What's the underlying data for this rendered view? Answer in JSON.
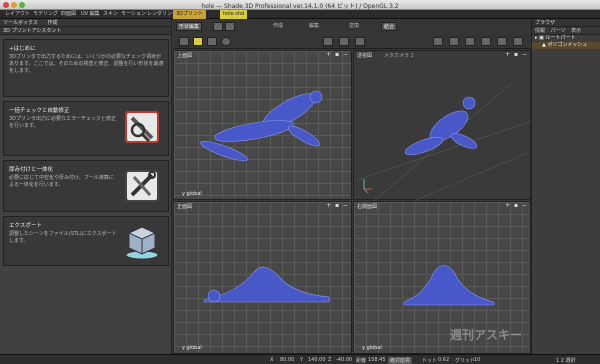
{
  "window": {
    "title": "hole — Shade 3D Professional ver.14.1.0 (64 ビット) / OpenGL 3.2"
  },
  "tabs": [
    {
      "label": "レイアウト"
    },
    {
      "label": "モデリング"
    },
    {
      "label": "四面図"
    },
    {
      "label": "UV 編集"
    },
    {
      "label": "スキン"
    },
    {
      "label": "モーション"
    },
    {
      "label": "レンダリング"
    },
    {
      "label": "3Dプリント"
    },
    {
      "label": "hole.shd"
    }
  ],
  "left_panel": {
    "toolbox_label": "ツールボックス",
    "create_label": "作成",
    "assistant_label": "3D プリントアシスタント",
    "cards": [
      {
        "title": "+はじめに",
        "desc": "3Dプリンタで出力するためには、いくつかの必要なチェック項目があります。ここでは、そのための検査と修正、調整を行い形状を最適化します。",
        "icon": "info-icon"
      },
      {
        "title": "一括チェックと自動修正",
        "desc": "3Dプリンタ出力に必要なエラーチェックと修正を行います。",
        "icon": "wrench-magnifier-icon"
      },
      {
        "title": "厚み付けと一体化",
        "desc": "必要に応じて中空化や厚み付け、ブール演算による一体化を行います。",
        "icon": "tools-icon"
      },
      {
        "title": "エクスポート",
        "desc": "調整したシーンをファイル(STL)にエクスポートします。",
        "icon": "cube-export-icon"
      }
    ]
  },
  "toolbar": {
    "shape_edit_label": "形状編集",
    "create_label": "作成",
    "edit_label": "編集",
    "transform_label": "変換",
    "join_label": "結合",
    "items": [
      "camera-icon",
      "cursor-icon",
      "grid-icon",
      "render-icon"
    ]
  },
  "viewports": [
    {
      "label": "上面図",
      "sub": "",
      "axis": "y global"
    },
    {
      "label": "透視図",
      "sub": "メタカメラ 1",
      "axis": ""
    },
    {
      "label": "正面図",
      "sub": "",
      "axis": "y global"
    },
    {
      "label": "右側面図",
      "sub": "",
      "axis": "y global"
    }
  ],
  "right_panel": {
    "header": "ブラウザ",
    "tabs": [
      "情報",
      "パーツ",
      "表示"
    ],
    "tree": [
      {
        "label": "ルートパート"
      },
      {
        "label": "ポリゴンメッシュ"
      }
    ]
  },
  "status": {
    "x_label": "X",
    "x": "80.00",
    "y_label": "Y",
    "y": "140.00",
    "z_label": "Z",
    "z": "-40.00",
    "dist_label": "距離",
    "dist": "158.45",
    "mode": "絶対座標",
    "dot_label": "ドット",
    "dot": "0.62",
    "grid_label": "グリッド",
    "grid": "10",
    "right": "1 2 選択"
  },
  "watermark": "週刊アスキー",
  "colors": {
    "accent_yellow": "#d8cc40",
    "print_tab": "#c8a23a",
    "mesh_blue": "#4858c8"
  }
}
